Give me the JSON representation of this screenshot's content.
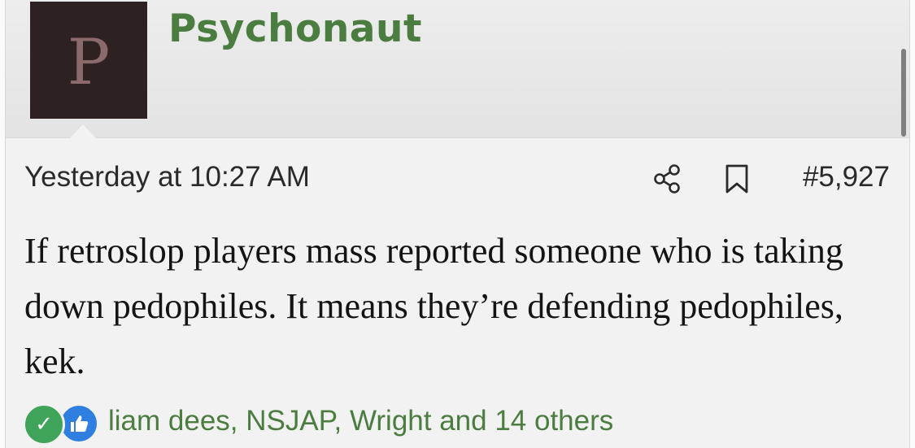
{
  "user": {
    "avatar_letter": "P",
    "name": "Psychonaut"
  },
  "post": {
    "timestamp": "Yesterday at 10:27 AM",
    "number": "#5,927",
    "body": "If retroslop players mass reported someone who is taking down pedophiles. It means they’re defending pedophiles, kek."
  },
  "reactions": {
    "icons": [
      "check-icon",
      "thumbs-up-icon"
    ],
    "summary": "liam dees, NSJAP, Wright and 14 others"
  },
  "colors": {
    "username": "#4a7d3f",
    "avatar_bg": "#2d2121",
    "avatar_letter": "#8a6a6a",
    "reaction_agree": "#3fa35a",
    "reaction_like": "#2f7fe0"
  }
}
